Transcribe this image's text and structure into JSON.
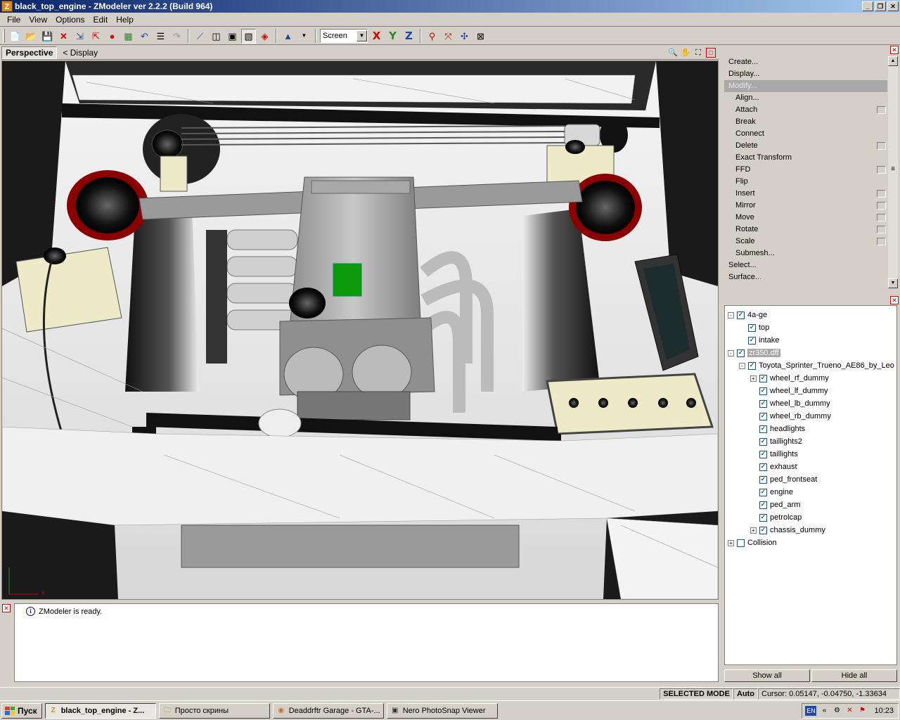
{
  "window": {
    "app_icon": "Z",
    "title": "black_top_engine - ZModeler ver 2.2.2 (Build 964)"
  },
  "menu": [
    {
      "label": "File",
      "key": "file"
    },
    {
      "label": "View",
      "key": "view"
    },
    {
      "label": "Options",
      "key": "options"
    },
    {
      "label": "Edit",
      "key": "edit"
    },
    {
      "label": "Help",
      "key": "help"
    }
  ],
  "toolbar": {
    "coordinate_select": "Screen",
    "axis_x": "X",
    "axis_y": "Y",
    "axis_z": "Z"
  },
  "viewport": {
    "tab": "Perspective",
    "display_link": "< Display"
  },
  "commands": [
    {
      "label": "Create...",
      "sub": false,
      "box": false,
      "active": false
    },
    {
      "label": "Display...",
      "sub": false,
      "box": false,
      "active": false
    },
    {
      "label": "Modify...",
      "sub": false,
      "box": false,
      "active": true
    },
    {
      "label": "Align...",
      "sub": true,
      "box": false,
      "active": false
    },
    {
      "label": "Attach",
      "sub": true,
      "box": true,
      "active": false
    },
    {
      "label": "Break",
      "sub": true,
      "box": false,
      "active": false
    },
    {
      "label": "Connect",
      "sub": true,
      "box": false,
      "active": false
    },
    {
      "label": "Delete",
      "sub": true,
      "box": true,
      "active": false
    },
    {
      "label": "Exact Transform",
      "sub": true,
      "box": false,
      "active": false
    },
    {
      "label": "FFD",
      "sub": true,
      "box": true,
      "active": false
    },
    {
      "label": "Flip",
      "sub": true,
      "box": false,
      "active": false
    },
    {
      "label": "Insert",
      "sub": true,
      "box": true,
      "active": false
    },
    {
      "label": "Mirror",
      "sub": true,
      "box": true,
      "active": false
    },
    {
      "label": "Move",
      "sub": true,
      "box": true,
      "active": false
    },
    {
      "label": "Rotate",
      "sub": true,
      "box": true,
      "active": false
    },
    {
      "label": "Scale",
      "sub": true,
      "box": true,
      "active": false
    },
    {
      "label": "Submesh...",
      "sub": true,
      "box": false,
      "active": false
    },
    {
      "label": "Select...",
      "sub": false,
      "box": false,
      "active": false
    },
    {
      "label": "Surface...",
      "sub": false,
      "box": false,
      "active": false
    }
  ],
  "tree": [
    {
      "label": "4a-ge",
      "level": 0,
      "expander": "-",
      "checked": true,
      "selected": false
    },
    {
      "label": "top",
      "level": 1,
      "expander": "",
      "checked": true,
      "selected": false
    },
    {
      "label": "intake",
      "level": 1,
      "expander": "",
      "checked": true,
      "selected": false
    },
    {
      "label": "zr350.dff",
      "level": 0,
      "expander": "-",
      "checked": true,
      "selected": true
    },
    {
      "label": "Toyota_Sprinter_Trueno_AE86_by_Leo",
      "level": 1,
      "expander": "-",
      "checked": true,
      "selected": false
    },
    {
      "label": "wheel_rf_dummy",
      "level": 2,
      "expander": "+",
      "checked": true,
      "selected": false
    },
    {
      "label": "wheel_lf_dummy",
      "level": 2,
      "expander": "",
      "checked": true,
      "selected": false
    },
    {
      "label": "wheel_lb_dummy",
      "level": 2,
      "expander": "",
      "checked": true,
      "selected": false
    },
    {
      "label": "wheel_rb_dummy",
      "level": 2,
      "expander": "",
      "checked": true,
      "selected": false
    },
    {
      "label": "headlights",
      "level": 2,
      "expander": "",
      "checked": true,
      "selected": false
    },
    {
      "label": "taillights2",
      "level": 2,
      "expander": "",
      "checked": true,
      "selected": false
    },
    {
      "label": "taillights",
      "level": 2,
      "expander": "",
      "checked": true,
      "selected": false
    },
    {
      "label": "exhaust",
      "level": 2,
      "expander": "",
      "checked": true,
      "selected": false
    },
    {
      "label": "ped_frontseat",
      "level": 2,
      "expander": "",
      "checked": true,
      "selected": false
    },
    {
      "label": "engine",
      "level": 2,
      "expander": "",
      "checked": true,
      "selected": false
    },
    {
      "label": "ped_arm",
      "level": 2,
      "expander": "",
      "checked": true,
      "selected": false
    },
    {
      "label": "petrolcap",
      "level": 2,
      "expander": "",
      "checked": true,
      "selected": false
    },
    {
      "label": "chassis_dummy",
      "level": 2,
      "expander": "+",
      "checked": true,
      "selected": false
    },
    {
      "label": "Collision",
      "level": 0,
      "expander": "+",
      "checked": false,
      "selected": false
    }
  ],
  "buttons": {
    "show_all": "Show all",
    "hide_all": "Hide all"
  },
  "log": {
    "message": "ZModeler is ready."
  },
  "status": {
    "mode": "SELECTED MODE",
    "auto": "Auto",
    "cursor": "Cursor: 0.05147, -0.04750, -1.33634"
  },
  "taskbar": {
    "start": "Пуск",
    "tasks": [
      {
        "label": "black_top_engine - Z...",
        "icon": "Z",
        "active": true
      },
      {
        "label": "Просто скрины",
        "icon": "folder-icon",
        "active": false
      },
      {
        "label": "Deaddrftr Garage - GTA-...",
        "icon": "firefox-icon",
        "active": false
      },
      {
        "label": "Nero PhotoSnap Viewer",
        "icon": "nero-icon",
        "active": false
      }
    ],
    "lang": "EN",
    "clock": "10:23"
  },
  "colors": {
    "title_start": "#0a246a",
    "title_end": "#a6caf0",
    "chrome": "#d4d0c8",
    "viewport_bg": "#ffffff"
  }
}
